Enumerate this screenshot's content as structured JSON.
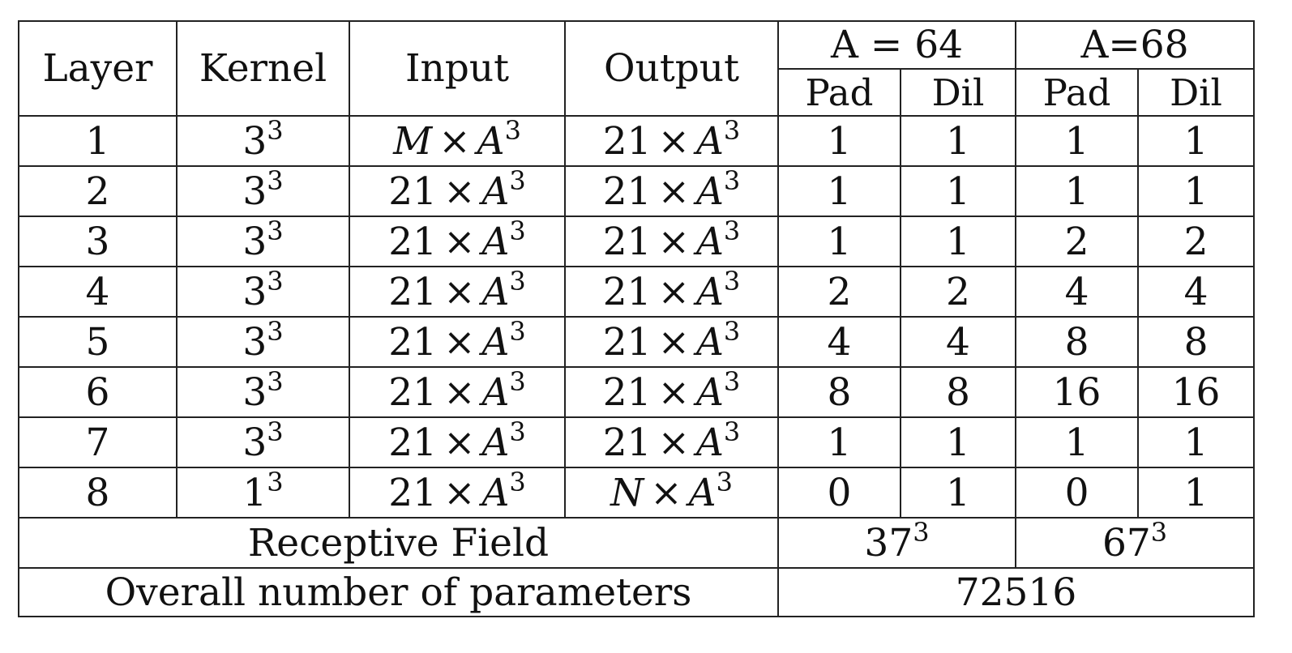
{
  "header": {
    "layer": "Layer",
    "kernel": "Kernel",
    "input": "Input",
    "output": "Output",
    "group_a64": "A = 64",
    "group_a68": "A=68",
    "pad": "Pad",
    "dil": "Dil"
  },
  "rows": [
    {
      "layer": "1",
      "kernel": {
        "base": "3",
        "exp": "3"
      },
      "input": {
        "base": "M",
        "base_italic": true,
        "times": "×",
        "var": "A",
        "exp": "3"
      },
      "output": {
        "base": "21",
        "base_italic": false,
        "times": "×",
        "var": "A",
        "exp": "3"
      },
      "a64_pad": "1",
      "a64_dil": "1",
      "a68_pad": "1",
      "a68_dil": "1"
    },
    {
      "layer": "2",
      "kernel": {
        "base": "3",
        "exp": "3"
      },
      "input": {
        "base": "21",
        "base_italic": false,
        "times": "×",
        "var": "A",
        "exp": "3"
      },
      "output": {
        "base": "21",
        "base_italic": false,
        "times": "×",
        "var": "A",
        "exp": "3"
      },
      "a64_pad": "1",
      "a64_dil": "1",
      "a68_pad": "1",
      "a68_dil": "1"
    },
    {
      "layer": "3",
      "kernel": {
        "base": "3",
        "exp": "3"
      },
      "input": {
        "base": "21",
        "base_italic": false,
        "times": "×",
        "var": "A",
        "exp": "3"
      },
      "output": {
        "base": "21",
        "base_italic": false,
        "times": "×",
        "var": "A",
        "exp": "3"
      },
      "a64_pad": "1",
      "a64_dil": "1",
      "a68_pad": "2",
      "a68_dil": "2"
    },
    {
      "layer": "4",
      "kernel": {
        "base": "3",
        "exp": "3"
      },
      "input": {
        "base": "21",
        "base_italic": false,
        "times": "×",
        "var": "A",
        "exp": "3"
      },
      "output": {
        "base": "21",
        "base_italic": false,
        "times": "×",
        "var": "A",
        "exp": "3"
      },
      "a64_pad": "2",
      "a64_dil": "2",
      "a68_pad": "4",
      "a68_dil": "4"
    },
    {
      "layer": "5",
      "kernel": {
        "base": "3",
        "exp": "3"
      },
      "input": {
        "base": "21",
        "base_italic": false,
        "times": "×",
        "var": "A",
        "exp": "3"
      },
      "output": {
        "base": "21",
        "base_italic": false,
        "times": "×",
        "var": "A",
        "exp": "3"
      },
      "a64_pad": "4",
      "a64_dil": "4",
      "a68_pad": "8",
      "a68_dil": "8"
    },
    {
      "layer": "6",
      "kernel": {
        "base": "3",
        "exp": "3"
      },
      "input": {
        "base": "21",
        "base_italic": false,
        "times": "×",
        "var": "A",
        "exp": "3"
      },
      "output": {
        "base": "21",
        "base_italic": false,
        "times": "×",
        "var": "A",
        "exp": "3"
      },
      "a64_pad": "8",
      "a64_dil": "8",
      "a68_pad": "16",
      "a68_dil": "16"
    },
    {
      "layer": "7",
      "kernel": {
        "base": "3",
        "exp": "3"
      },
      "input": {
        "base": "21",
        "base_italic": false,
        "times": "×",
        "var": "A",
        "exp": "3"
      },
      "output": {
        "base": "21",
        "base_italic": false,
        "times": "×",
        "var": "A",
        "exp": "3"
      },
      "a64_pad": "1",
      "a64_dil": "1",
      "a68_pad": "1",
      "a68_dil": "1"
    },
    {
      "layer": "8",
      "kernel": {
        "base": "1",
        "exp": "3"
      },
      "input": {
        "base": "21",
        "base_italic": false,
        "times": "×",
        "var": "A",
        "exp": "3"
      },
      "output": {
        "base": "N",
        "base_italic": true,
        "times": "×",
        "var": "A",
        "exp": "3"
      },
      "a64_pad": "0",
      "a64_dil": "1",
      "a68_pad": "0",
      "a68_dil": "1"
    }
  ],
  "footer": {
    "receptive_label": "Receptive Field",
    "receptive_a64": {
      "base": "37",
      "exp": "3"
    },
    "receptive_a68": {
      "base": "67",
      "exp": "3"
    },
    "params_label": "Overall number of parameters",
    "params_value": "72516"
  }
}
